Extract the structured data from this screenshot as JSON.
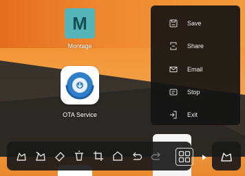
{
  "apps": [
    {
      "letter": "M",
      "label": "Montage"
    },
    {
      "label": "OTA Service"
    }
  ],
  "menu": {
    "items": [
      {
        "label": "Save",
        "icon": "save-icon"
      },
      {
        "label": "Share",
        "icon": "share-icon"
      },
      {
        "label": "Email",
        "icon": "email-icon"
      },
      {
        "label": "Stop",
        "icon": "stop-icon"
      },
      {
        "label": "Exit",
        "icon": "exit-icon"
      }
    ]
  },
  "toolbar": {
    "tools": [
      "pen-icon",
      "eraser-pen-icon",
      "eraser-icon",
      "clear-icon",
      "crop-icon",
      "home-icon",
      "undo-icon",
      "redo-icon",
      "more-grid-icon"
    ]
  },
  "colors": {
    "accent": "#f0822a",
    "menu_bg": "#141414",
    "tile_teal": "#55b5b8"
  }
}
